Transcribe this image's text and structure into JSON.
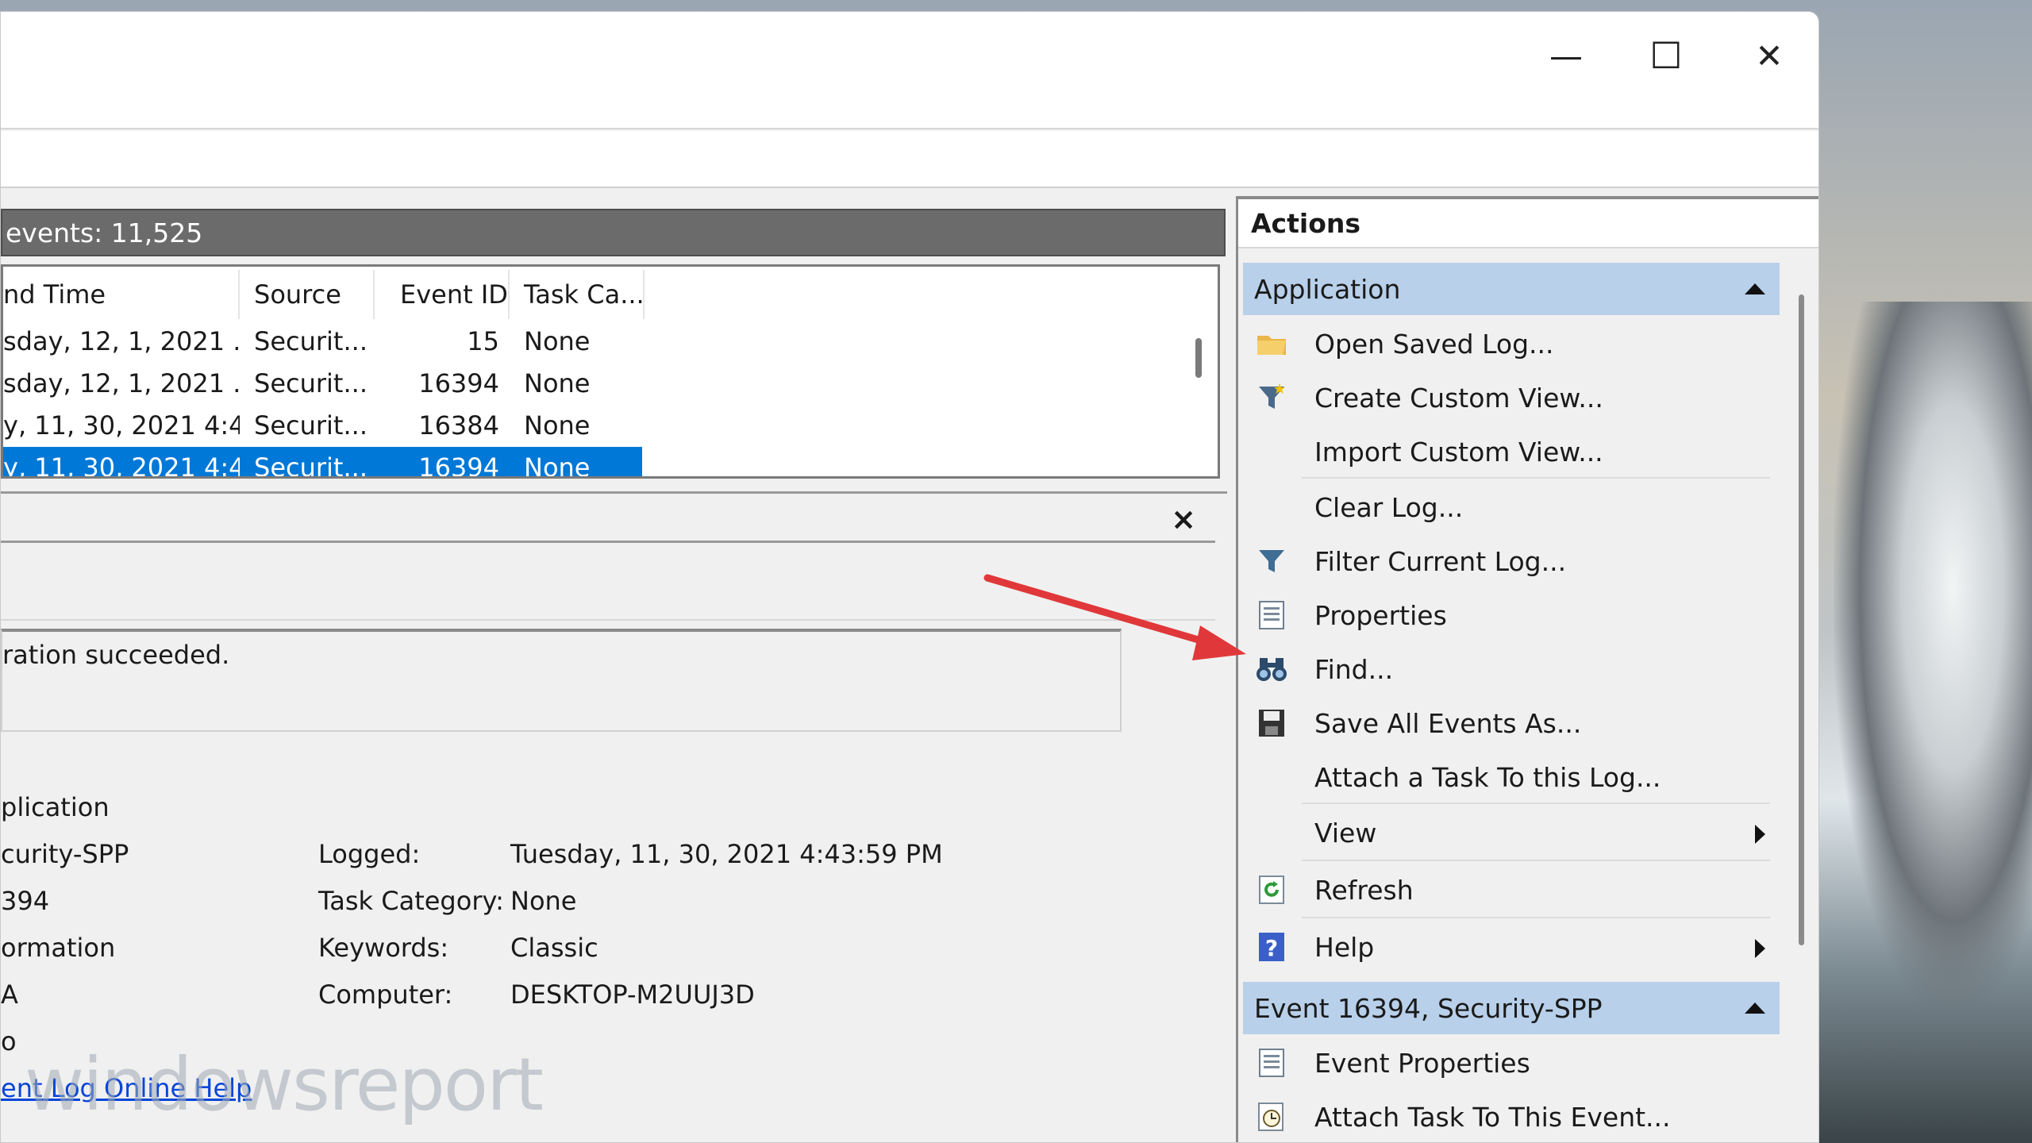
{
  "window": {
    "minimize": "—",
    "maximize": "☐",
    "close": "✕"
  },
  "events_header": "events: 11,525",
  "columns": [
    "nd Time",
    "Source",
    "Event ID",
    "Task Ca..."
  ],
  "rows": [
    {
      "time": "sday, 12, 1, 2021 ...",
      "source": "Securit...",
      "id": "15",
      "task": "None",
      "selected": false
    },
    {
      "time": "sday, 12, 1, 2021 ...",
      "source": "Securit...",
      "id": "16394",
      "task": "None",
      "selected": false
    },
    {
      "time": "y, 11, 30, 2021 4:4...",
      "source": "Securit...",
      "id": "16384",
      "task": "None",
      "selected": false
    },
    {
      "time": "y, 11, 30, 2021 4:4...",
      "source": "Securit...",
      "id": "16394",
      "task": "None",
      "selected": true
    }
  ],
  "detail": {
    "close": "×",
    "description": "ration succeeded.",
    "left_values": [
      "plication",
      "curity-SPP",
      "394",
      "ormation",
      "A",
      "o"
    ],
    "labels": [
      "Logged:",
      "Task Category:",
      "Keywords:",
      "Computer:"
    ],
    "values": [
      "Tuesday, 11, 30, 2021 4:43:59 PM",
      "None",
      "Classic",
      "DESKTOP-M2UUJ3D"
    ],
    "help_link": "ent Log Online Help"
  },
  "watermark": "windowsreport",
  "actions": {
    "title": "Actions",
    "group1": "Application",
    "items1": [
      {
        "label": "Open Saved Log...",
        "icon": "folder-icon"
      },
      {
        "label": "Create Custom View...",
        "icon": "filter-star-icon"
      },
      {
        "label": "Import Custom View...",
        "icon": ""
      },
      {
        "label": "Clear Log...",
        "icon": ""
      },
      {
        "label": "Filter Current Log...",
        "icon": "filter-icon"
      },
      {
        "label": "Properties",
        "icon": "properties-icon"
      },
      {
        "label": "Find...",
        "icon": "binoculars-icon"
      },
      {
        "label": "Save All Events As...",
        "icon": "save-icon"
      },
      {
        "label": "Attach a Task To this Log...",
        "icon": ""
      },
      {
        "label": "View",
        "icon": ""
      },
      {
        "label": "Refresh",
        "icon": "refresh-icon"
      },
      {
        "label": "Help",
        "icon": "help-icon"
      }
    ],
    "group2": "Event 16394, Security-SPP",
    "items2": [
      {
        "label": "Event Properties",
        "icon": "properties-icon"
      },
      {
        "label": "Attach Task To This Event...",
        "icon": "task-clock-icon"
      }
    ]
  },
  "colors": {
    "selection": "#0078d7",
    "group_bg": "#b8d0ea",
    "arrow": "#e0383a"
  }
}
